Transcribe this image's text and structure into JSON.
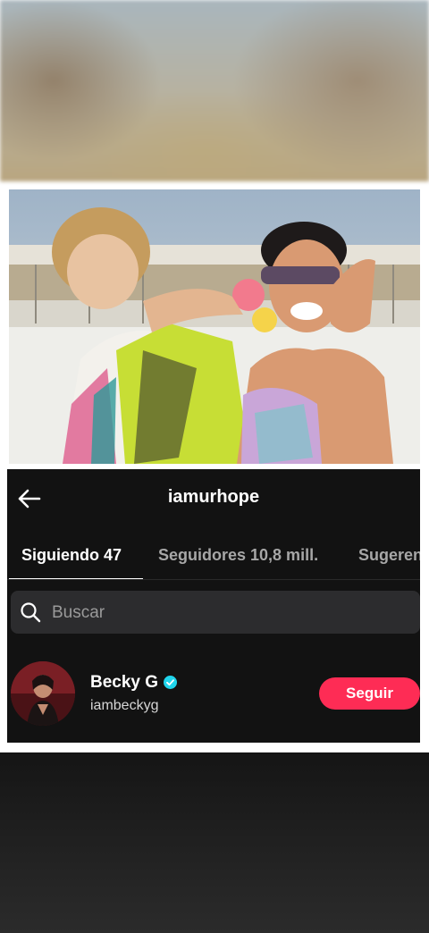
{
  "header": {
    "title": "iamurhope"
  },
  "tabs": [
    {
      "label": "Siguiendo 47",
      "active": true
    },
    {
      "label": "Seguidores 10,8 mill.",
      "active": false
    },
    {
      "label": "Sugeren",
      "active": false
    }
  ],
  "search": {
    "placeholder": "Buscar"
  },
  "list": [
    {
      "name": "Becky G",
      "handle": "iambeckyg",
      "verified": true,
      "action_label": "Seguir"
    }
  ],
  "colors": {
    "accent": "#fe2c55",
    "verified": "#20d5ec",
    "panel_bg": "#121212",
    "search_bg": "#2c2c2e"
  },
  "icons": {
    "back": "arrow-left-icon",
    "search": "search-icon",
    "verified": "verified-badge-icon"
  }
}
